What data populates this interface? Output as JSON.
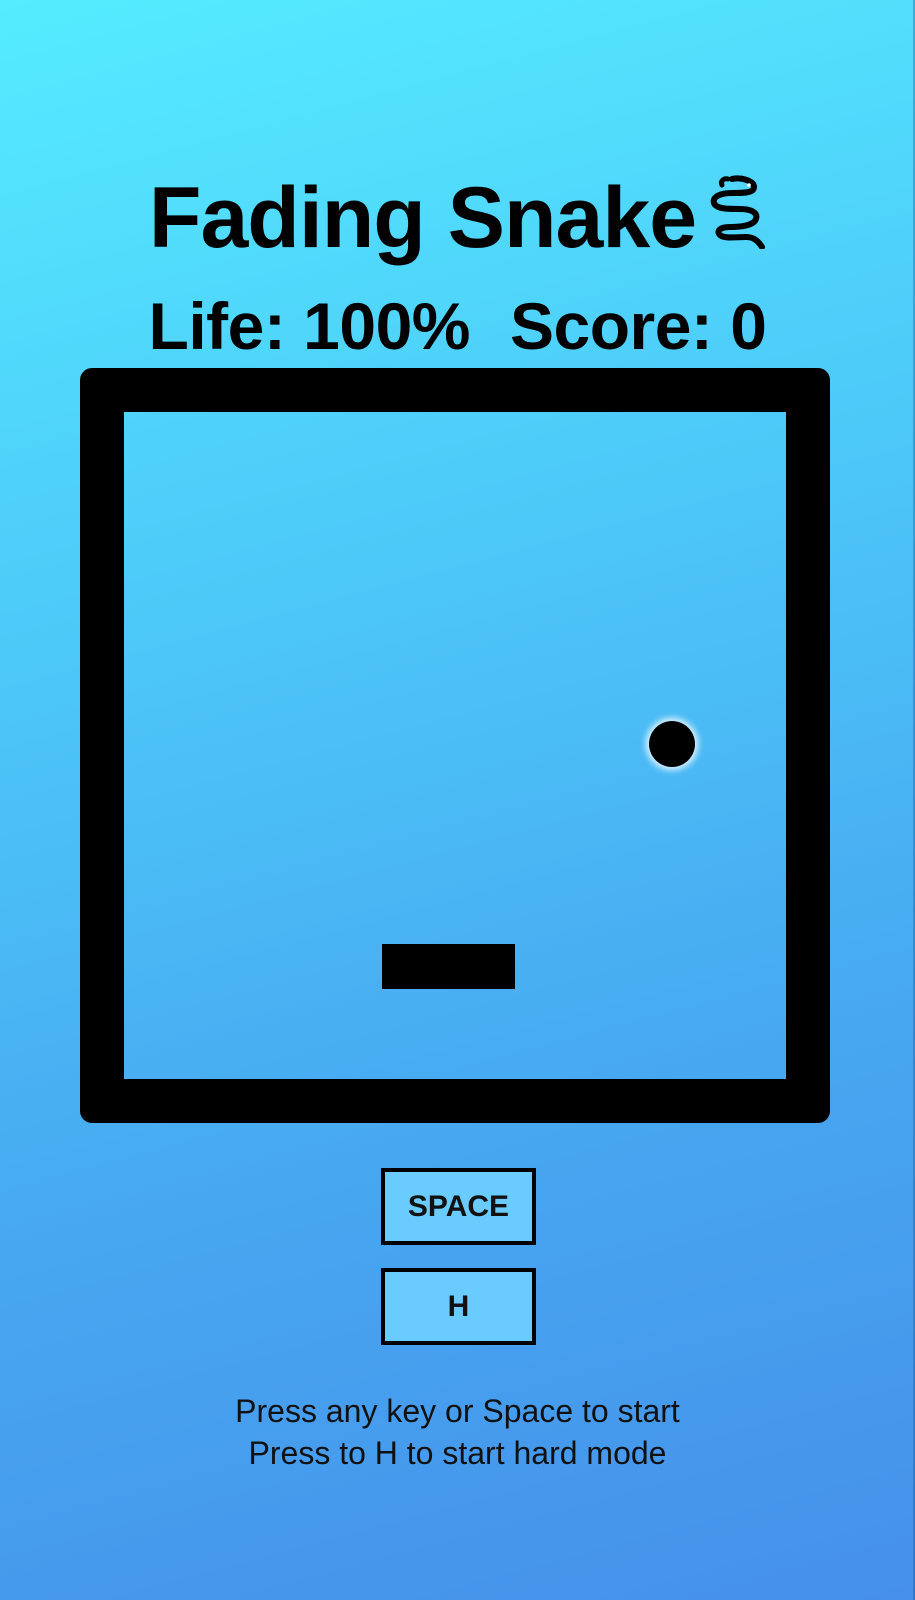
{
  "title": "Fading Snake",
  "title_icon": "snake-icon",
  "stats": {
    "life": "Life: 100%",
    "score": "Score: 0"
  },
  "game": {
    "life_percent": 100,
    "score": 0
  },
  "buttons": {
    "space_label": "SPACE",
    "h_label": "H"
  },
  "instructions": {
    "line1": "Press any key or Space to start",
    "line2": "Press to H to start hard mode"
  },
  "colors": {
    "background_top": "#55ecff",
    "background_bottom": "#4690ea",
    "button_fill": "#69cbff",
    "foreground": "#000000"
  }
}
